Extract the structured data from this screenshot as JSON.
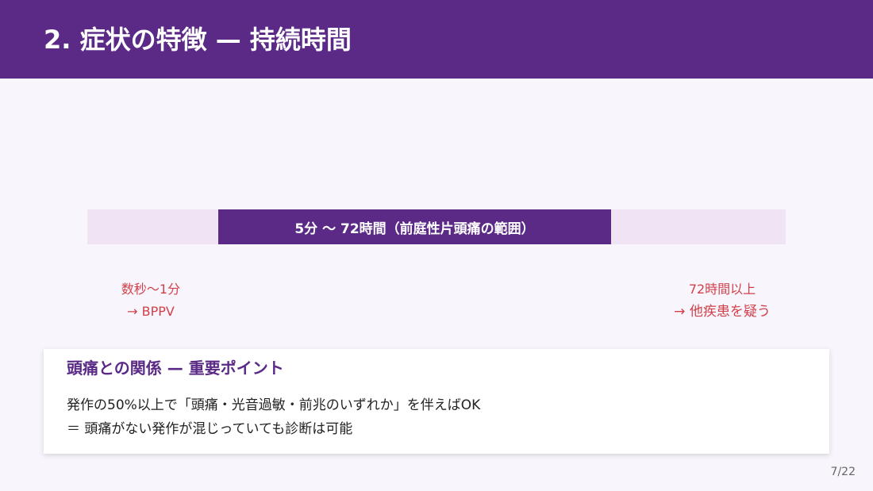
{
  "header": {
    "title": "2. 症状の特徴 — 持続時間",
    "background_color": "#5b2a86"
  },
  "timeline": {
    "range_label": "5分 〜 72時間（前庭性片頭痛の範囲）",
    "left_note": {
      "line1": "数秒〜1分",
      "line2": "→ BPPV"
    },
    "right_note": {
      "line1": "72時間以上",
      "line2": "→ 他疾患を疑う"
    },
    "range_color": "#5b2a86",
    "track_color": "#f0e3f4",
    "note_color": "#d2414a"
  },
  "card": {
    "heading": "頭痛との関係 — 重要ポイント",
    "lines": [
      "発作の50%以上で「頭痛・光音過敏・前兆のいずれか」を伴えばOK",
      "＝ 頭痛がない発作が混じっていても診断は可能"
    ]
  },
  "footer": {
    "page_number": "7/22"
  }
}
